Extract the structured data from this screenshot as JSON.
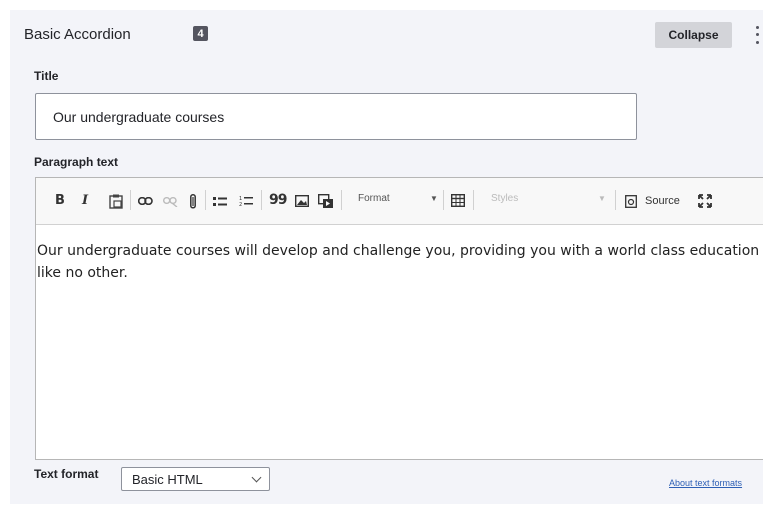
{
  "paragraph": {
    "header_title": "Basic Accordion",
    "badge": "4",
    "collapse_label": "Collapse"
  },
  "fields": {
    "title_label": "Title",
    "title_value": "Our undergraduate courses",
    "paragraph_label": "Paragraph text"
  },
  "toolbar": {
    "bold": "B",
    "italic": "I",
    "blockquote": "99",
    "format_label": "Format",
    "styles_label": "Styles",
    "source_label": "Source"
  },
  "editor": {
    "content": "Our undergraduate courses will develop and challenge you, providing you with a world class education like no other."
  },
  "text_format": {
    "label": "Text format",
    "selected": "Basic HTML",
    "about_link": "About text formats"
  },
  "colors": {
    "panel_bg": "#f3f4f9",
    "badge_bg": "#545560",
    "link": "#2d5fb5"
  }
}
